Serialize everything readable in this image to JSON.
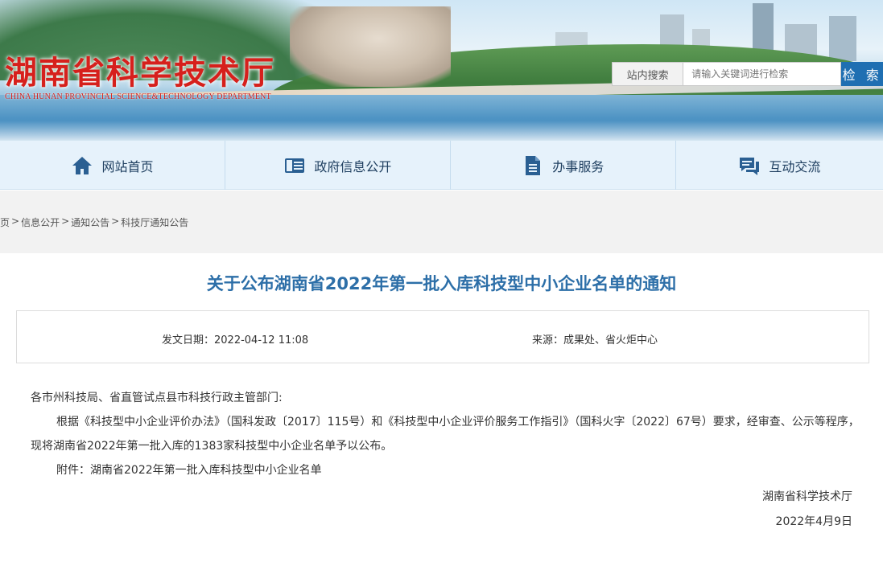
{
  "header": {
    "logo_cn": "湖南省科学技术厅",
    "logo_en": "CHINA HUNAN PROVINCIAL SCIENCE&TECHNOLOGY DEPARTMENT",
    "search": {
      "scope": "站内搜索",
      "placeholder": "请输入关键词进行检索",
      "button": "检 索"
    }
  },
  "nav": {
    "items": [
      {
        "label": "网站首页",
        "icon": "home-icon"
      },
      {
        "label": "政府信息公开",
        "icon": "book-icon"
      },
      {
        "label": "办事服务",
        "icon": "document-icon"
      },
      {
        "label": "互动交流",
        "icon": "chat-icon"
      }
    ]
  },
  "breadcrumb": {
    "items": [
      "页",
      "信息公开",
      "通知公告",
      "科技厅通知公告"
    ],
    "separator": ">"
  },
  "article": {
    "title": "关于公布湖南省2022年第一批入库科技型中小企业名单的通知",
    "date_label": "发文日期：",
    "date_value": "2022-04-12 11:08",
    "source_label": "来源：",
    "source_value": "成果处、省火炬中心",
    "salutation": "各市州科技局、省直管试点县市科技行政主管部门:",
    "body": "根据《科技型中小企业评价办法》（国科发政〔2017〕115号）和《科技型中小企业评价服务工作指引》（国科火字〔2022〕67号）要求，经审查、公示等程序，现将湖南省2022年第一批入库的1383家科技型中小企业名单予以公布。",
    "attachment_label": "附件：",
    "attachment_link": "湖南省2022年第一批入库科技型中小企业名单",
    "signature": "湖南省科学技术厅",
    "sign_date": "2022年4月9日"
  },
  "colors": {
    "logo_red": "#d6201c",
    "title_blue": "#2d6fa8",
    "nav_bg": "#e6f2fb",
    "search_button": "#1f6fb2"
  }
}
